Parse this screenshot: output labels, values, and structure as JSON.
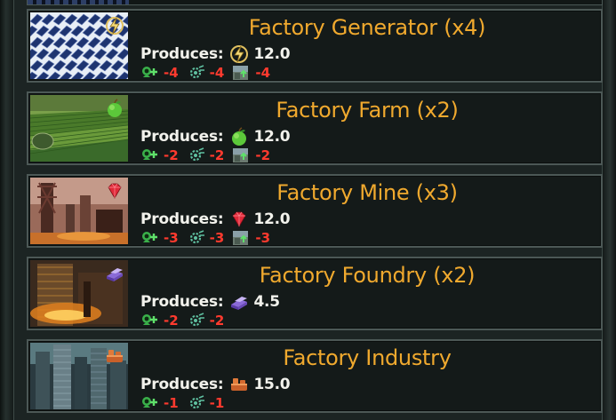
{
  "colors": {
    "title": "#f0a92e",
    "text": "#f2f2ec",
    "negative": "#ff3a2e",
    "row_bg": "#141a19",
    "row_border": "#4c5856"
  },
  "labels": {
    "produces": "Produces:"
  },
  "buildings": [
    {
      "title": "Factory Generator (x4)",
      "thumbnail": "solar-panels-image",
      "resource_icon": "energy-icon",
      "produces_value": "12.0",
      "upkeep": [
        {
          "icon": "pop-growth-icon",
          "value": "-4"
        },
        {
          "icon": "research-cog-icon",
          "value": "-4"
        },
        {
          "icon": "terrain-tile-icon",
          "value": "-4"
        }
      ]
    },
    {
      "title": "Factory Farm (x2)",
      "thumbnail": "farm-fields-image",
      "resource_icon": "food-apple-icon",
      "produces_value": "12.0",
      "upkeep": [
        {
          "icon": "pop-growth-icon",
          "value": "-2"
        },
        {
          "icon": "research-cog-icon",
          "value": "-2"
        },
        {
          "icon": "terrain-tile-icon",
          "value": "-2"
        }
      ]
    },
    {
      "title": "Factory Mine (x3)",
      "thumbnail": "mine-tower-image",
      "resource_icon": "mineral-gem-icon",
      "produces_value": "12.0",
      "upkeep": [
        {
          "icon": "pop-growth-icon",
          "value": "-3"
        },
        {
          "icon": "research-cog-icon",
          "value": "-3"
        },
        {
          "icon": "terrain-tile-icon",
          "value": "-3"
        }
      ]
    },
    {
      "title": "Factory Foundry (x2)",
      "thumbnail": "foundry-furnace-image",
      "resource_icon": "alloy-ingot-icon",
      "produces_value": "4.5",
      "upkeep": [
        {
          "icon": "pop-growth-icon",
          "value": "-2"
        },
        {
          "icon": "research-cog-icon",
          "value": "-2"
        }
      ]
    },
    {
      "title": "Factory Industry",
      "thumbnail": "industry-city-image",
      "resource_icon": "consumer-goods-icon",
      "produces_value": "15.0",
      "upkeep": [
        {
          "icon": "pop-growth-icon",
          "value": "-1"
        },
        {
          "icon": "research-cog-icon",
          "value": "-1"
        }
      ]
    }
  ]
}
